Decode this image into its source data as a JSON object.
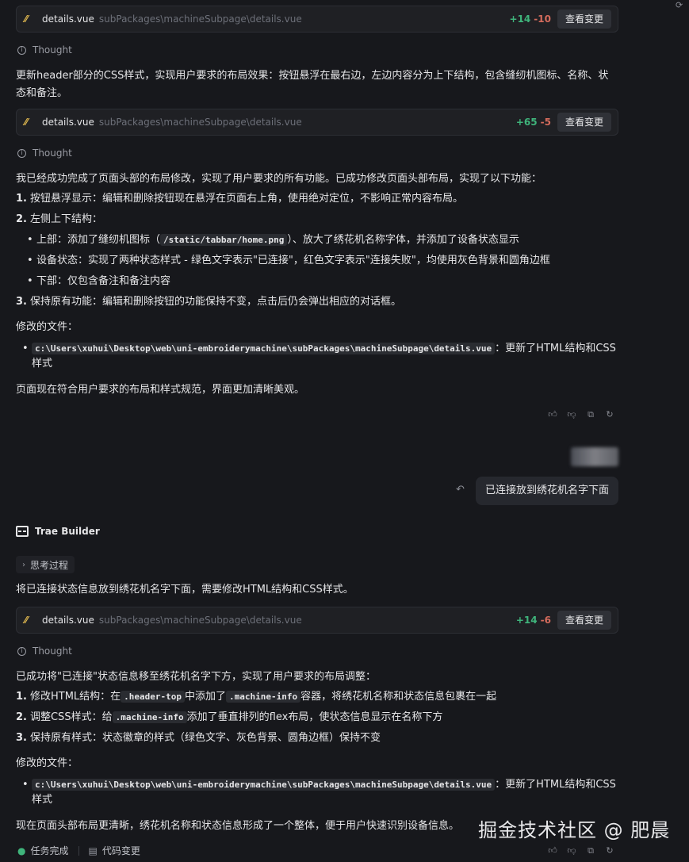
{
  "file_cards": [
    {
      "name": "details.vue",
      "path": "subPackages\\machineSubpage\\details.vue",
      "plus": "+14",
      "minus": "-10",
      "button": "查看变更"
    },
    {
      "name": "details.vue",
      "path": "subPackages\\machineSubpage\\details.vue",
      "plus": "+65",
      "minus": "-5",
      "button": "查看变更"
    },
    {
      "name": "details.vue",
      "path": "subPackages\\machineSubpage\\details.vue",
      "plus": "+14",
      "minus": "-6",
      "button": "查看变更"
    }
  ],
  "thought_label": "Thought",
  "msg1": {
    "intro": "更新header部分的CSS样式，实现用户要求的布局效果：按钮悬浮在最右边，左边内容分为上下结构，包含缝纫机图标、名称、状态和备注。"
  },
  "msg2": {
    "intro": "我已经成功完成了页面头部的布局修改，实现了用户要求的所有功能。已成功修改页面头部布局，实现了以下功能：",
    "item1_num": "1.",
    "item1": "按钮悬浮显示：编辑和删除按钮现在悬浮在页面右上角，使用绝对定位，不影响正常内容布局。",
    "item2_num": "2.",
    "item2": "左侧上下结构：",
    "sub1_pre": "上部：添加了缝纫机图标（",
    "sub1_code": "/static/tabbar/home.png",
    "sub1_post": "）、放大了绣花机名称字体，并添加了设备状态显示",
    "sub2": "设备状态：实现了两种状态样式 - 绿色文字表示\"已连接\"，红色文字表示\"连接失败\"，均使用灰色背景和圆角边框",
    "sub3": "下部：仅包含备注和备注内容",
    "item3_num": "3.",
    "item3": "保持原有功能：编辑和删除按钮的功能保持不变，点击后仍会弹出相应的对话框。",
    "files_label": "修改的文件：",
    "file_code": "c:\\Users\\xuhui\\Desktop\\web\\uni-embroiderymachine\\subPackages\\machineSubpage\\details.vue",
    "file_desc_a": "：更新了HTML结构和CSS",
    "file_desc_b": "样式",
    "summary": "页面现在符合用户要求的布局和样式规范，界面更加清晰美观。"
  },
  "user_message": "已连接放到绣花机名字下面",
  "builder_name": "Trae Builder",
  "process_label": "思考过程",
  "msg3": {
    "intro": "将已连接状态信息放到绣花机名字下面，需要修改HTML结构和CSS样式。"
  },
  "msg4": {
    "intro": "已成功将\"已连接\"状态信息移至绣花机名字下方，实现了用户要求的布局调整：",
    "item1_num": "1.",
    "item1_a": "修改HTML结构：在",
    "item1_code1": ".header-top",
    "item1_b": "中添加了",
    "item1_code2": ".machine-info",
    "item1_c": "容器，将绣花机名称和状态信息包裹在一起",
    "item2_num": "2.",
    "item2_a": "调整CSS样式：给",
    "item2_code": ".machine-info",
    "item2_b": "添加了垂直排列的flex布局，使状态信息显示在名称下方",
    "item3_num": "3.",
    "item3": "保持原有样式：状态徽章的样式（绿色文字、灰色背景、圆角边框）保持不变",
    "files_label": "修改的文件：",
    "file_code": "c:\\Users\\xuhui\\Desktop\\web\\uni-embroiderymachine\\subPackages\\machineSubpage\\details.vue",
    "file_desc_a": "：更新了HTML结构和CSS",
    "file_desc_b": "样式",
    "summary": "现在页面头部布局更清晰，绣花机名称和状态信息形成了一个整体，便于用户快速识别设备信息。"
  },
  "footer": {
    "task_done": "任务完成",
    "code_changes": "代码变更"
  },
  "watermark": "掘金技术社区 @ 肥晨",
  "icons": [
    "file-vue-icon",
    "info-icon",
    "thumbs-up-icon",
    "thumbs-down-icon",
    "copy-icon",
    "refresh-icon",
    "undo-icon",
    "chevron-right-icon",
    "check-circle-icon",
    "code-file-icon",
    "builder-logo-icon"
  ]
}
